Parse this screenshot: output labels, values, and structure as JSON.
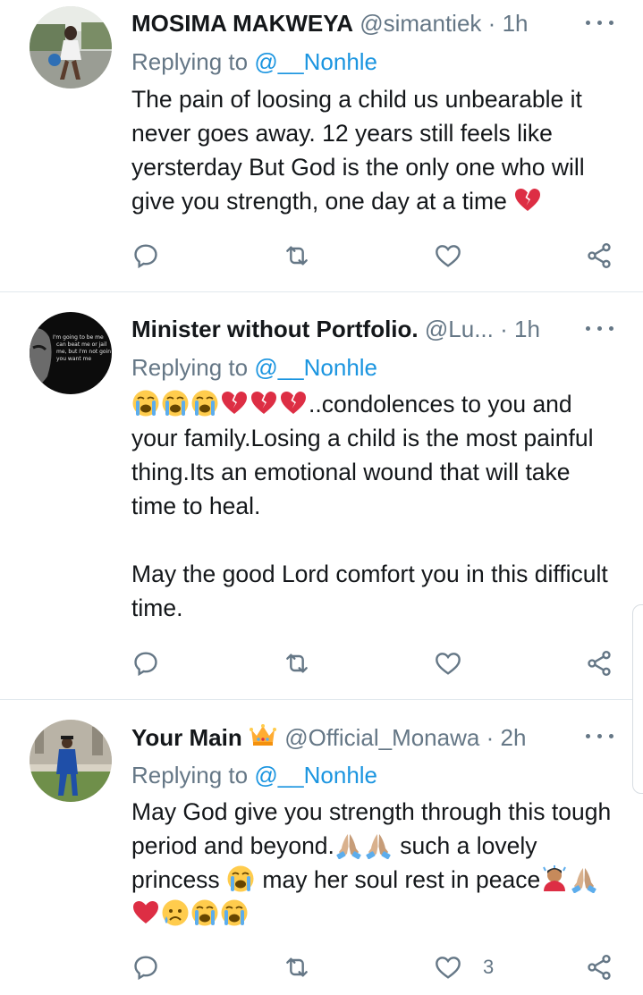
{
  "colors": {
    "accent": "#1b95e0",
    "muted": "#657786",
    "text": "#14171a",
    "divider": "#e1e8ed"
  },
  "tweets": [
    {
      "name": "MOSIMA MAKWEYA",
      "handle": "@simantiek",
      "dot": "·",
      "time": "1h",
      "reply_prefix": "Replying to",
      "reply_to": "@__Nonhle",
      "text": "The pain of loosing a child us unbearable it never goes away. 12 years still feels like yersterday But God is the only one who will give you strength, one day at a time",
      "like_count": ""
    },
    {
      "name": "Minister without Portfolio.",
      "handle": "@Lu...",
      "dot": "·",
      "time": "1h",
      "reply_prefix": "Replying to",
      "reply_to": "@__Nonhle",
      "avatar_text": "I'm going to be me can beat me or jail me, but I'm not goin you want me",
      "text": "..condolences to you and your family.Losing a child is the most painful thing.Its an emotional wound that will take time to heal.",
      "text2": "May the good Lord comfort you in this difficult time.",
      "like_count": ""
    },
    {
      "name": "Your Main",
      "handle": "@Official_Monawa",
      "dot": "·",
      "time": "2h",
      "reply_prefix": "Replying to",
      "reply_to": "@__Nonhle",
      "text_a": "May God give you strength through this tough period and beyond.",
      "text_b": " such a lovely princess ",
      "text_c": " may her soul rest in peace",
      "like_count": "3"
    }
  ],
  "icons": [
    "reply-icon",
    "retweet-icon",
    "like-icon",
    "share-icon",
    "more-icon",
    "broken-heart-emoji",
    "crying-face-emoji",
    "folded-hands-emoji",
    "crown-emoji",
    "red-heart-emoji"
  ]
}
